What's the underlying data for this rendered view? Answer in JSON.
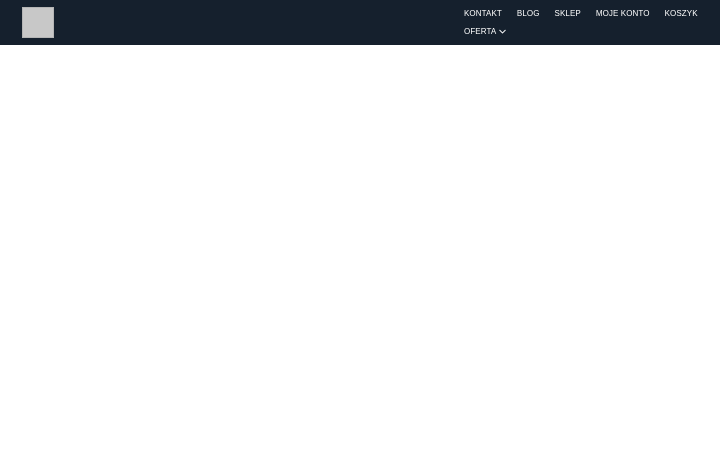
{
  "header": {
    "background": "#15202d",
    "logo_icon": "logo-placeholder",
    "nav": {
      "row1": [
        "KONTAKT",
        "BLOG",
        "SKLEP",
        "MOJE KONTO",
        "KOSZYK"
      ],
      "row2": {
        "label": "OFERTA",
        "icon": "chevron-down-icon"
      }
    }
  }
}
